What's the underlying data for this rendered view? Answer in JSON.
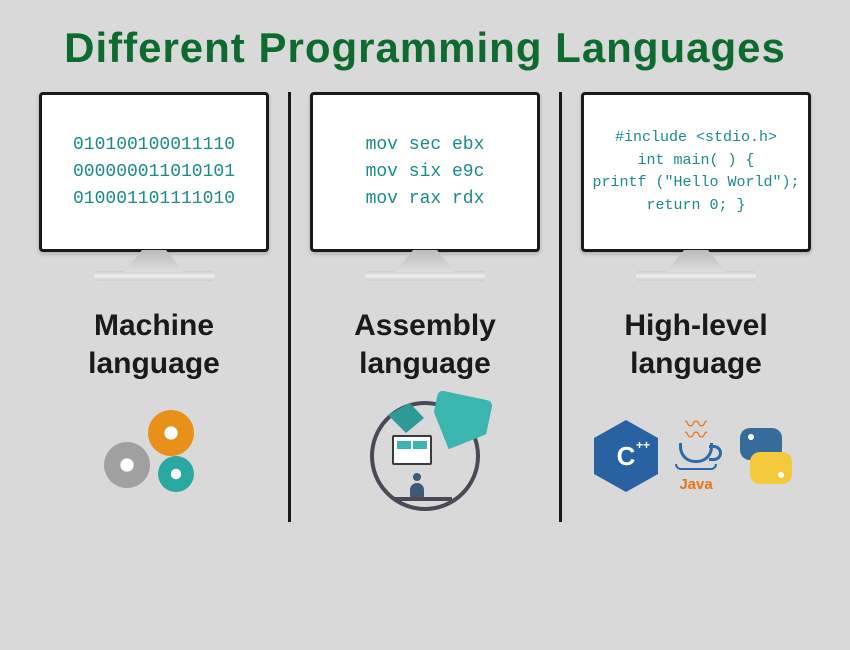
{
  "title": "Different Programming Languages",
  "columns": {
    "machine": {
      "label": "Machine\nlanguage",
      "screen": {
        "line1": "010100100011110",
        "line2": "000000011010101",
        "line3": "010001101111010"
      }
    },
    "assembly": {
      "label": "Assembly\nlanguage",
      "screen": {
        "line1": "mov sec ebx",
        "line2": "mov six e9c",
        "line3": "mov rax rdx"
      }
    },
    "highlevel": {
      "label": "High-level\nlanguage",
      "screen": {
        "line1": "#include <stdio.h>",
        "line2": "int main( ) {",
        "line3": "printf (\"Hello World\");",
        "line4": "return 0; }"
      },
      "logos": {
        "cpp": "C",
        "cpp_plus": "++",
        "java": "Java"
      }
    }
  }
}
